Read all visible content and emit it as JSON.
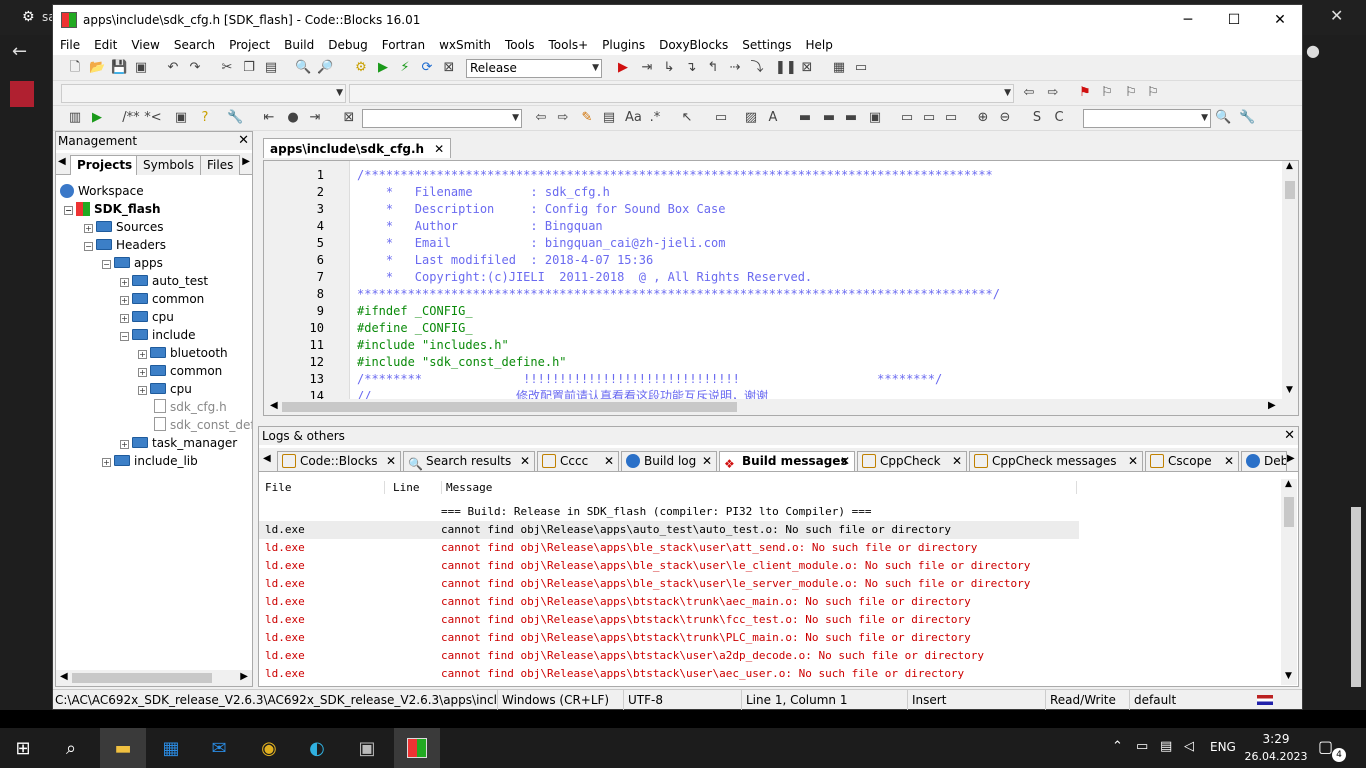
{
  "window": {
    "title": "apps\\include\\sdk_cfg.h [SDK_flash] - Code::Blocks 16.01"
  },
  "bg": {
    "left_text": "sa"
  },
  "menu": [
    "File",
    "Edit",
    "View",
    "Search",
    "Project",
    "Build",
    "Debug",
    "Fortran",
    "wxSmith",
    "Tools",
    "Tools+",
    "Plugins",
    "DoxyBlocks",
    "Settings",
    "Help"
  ],
  "toolbar": {
    "build_target": "Release",
    "comment_labels": [
      "/**",
      "*<"
    ],
    "scope_combo": "",
    "search_combo": ""
  },
  "management": {
    "title": "Management",
    "tabs": [
      "Projects",
      "Symbols",
      "Files"
    ],
    "tree": [
      {
        "label": "Workspace",
        "level": 0
      },
      {
        "label": "SDK_flash",
        "level": 1
      },
      {
        "label": "Sources",
        "level": 2
      },
      {
        "label": "Headers",
        "level": 2
      },
      {
        "label": "apps",
        "level": 3
      },
      {
        "label": "auto_test",
        "level": 4
      },
      {
        "label": "common",
        "level": 4
      },
      {
        "label": "cpu",
        "level": 4
      },
      {
        "label": "include",
        "level": 4
      },
      {
        "label": "bluetooth",
        "level": 5
      },
      {
        "label": "common",
        "level": 5
      },
      {
        "label": "cpu",
        "level": 5
      },
      {
        "label": "sdk_cfg.h",
        "level": 5
      },
      {
        "label": "sdk_const_def",
        "level": 5
      },
      {
        "label": "task_manager",
        "level": 4
      },
      {
        "label": "include_lib",
        "level": 3
      }
    ]
  },
  "editor": {
    "tab": "apps\\include\\sdk_cfg.h",
    "lines": [
      {
        "n": "1",
        "text": "/***************************************************************************************",
        "cls": "cm"
      },
      {
        "n": "2",
        "text": "    *   Filename        : sdk_cfg.h",
        "cls": "cm"
      },
      {
        "n": "3",
        "text": "    *   Description     : Config for Sound Box Case",
        "cls": "cm"
      },
      {
        "n": "4",
        "text": "    *   Author          : Bingquan",
        "cls": "cm"
      },
      {
        "n": "5",
        "text": "    *   Email           : bingquan_cai@zh-jieli.com",
        "cls": "cm"
      },
      {
        "n": "6",
        "text": "    *   Last modifiled  : 2018-4-07 15:36",
        "cls": "cm"
      },
      {
        "n": "7",
        "text": "    *   Copyright:(c)JIELI  2011-2018  @ , All Rights Reserved.",
        "cls": "cm"
      },
      {
        "n": "8",
        "text": "****************************************************************************************/",
        "cls": "cm"
      },
      {
        "n": "9",
        "text": "#ifndef _CONFIG_",
        "cls": "pp"
      },
      {
        "n": "10",
        "text": "#define _CONFIG_",
        "cls": "pp"
      },
      {
        "n": "11",
        "text": "#include \"includes.h\"",
        "cls": "pp"
      },
      {
        "n": "12",
        "text": "#include \"sdk_const_define.h\"",
        "cls": "pp"
      },
      {
        "n": "13",
        "text": "/********              !!!!!!!!!!!!!!!!!!!!!!!!!!!!!!                   ********/",
        "cls": "cm"
      },
      {
        "n": "14",
        "text": "//                    修改配置前请认真看看这段功能互斥说明，谢谢",
        "cls": "cm"
      }
    ]
  },
  "logs": {
    "title": "Logs & others",
    "tabs": [
      "Code::Blocks",
      "Search results",
      "Cccc",
      "Build log",
      "Build messages",
      "CppCheck",
      "CppCheck messages",
      "Cscope",
      "Debu"
    ],
    "columns": [
      "File",
      "Line",
      "Message"
    ],
    "header_msg": "=== Build: Release in SDK_flash (compiler: PI32 lto Compiler) ===",
    "rows": [
      {
        "file": "ld.exe",
        "msg": "cannot find obj\\Release\\apps\\auto_test\\auto_test.o: No such file or directory",
        "sel": true
      },
      {
        "file": "ld.exe",
        "msg": "cannot find obj\\Release\\apps\\ble_stack\\user\\att_send.o: No such file or directory"
      },
      {
        "file": "ld.exe",
        "msg": "cannot find obj\\Release\\apps\\ble_stack\\user\\le_client_module.o: No such file or directory"
      },
      {
        "file": "ld.exe",
        "msg": "cannot find obj\\Release\\apps\\ble_stack\\user\\le_server_module.o: No such file or directory"
      },
      {
        "file": "ld.exe",
        "msg": "cannot find obj\\Release\\apps\\btstack\\trunk\\aec_main.o: No such file or directory"
      },
      {
        "file": "ld.exe",
        "msg": "cannot find obj\\Release\\apps\\btstack\\trunk\\fcc_test.o: No such file or directory"
      },
      {
        "file": "ld.exe",
        "msg": "cannot find obj\\Release\\apps\\btstack\\trunk\\PLC_main.o: No such file or directory"
      },
      {
        "file": "ld.exe",
        "msg": "cannot find obj\\Release\\apps\\btstack\\user\\a2dp_decode.o: No such file or directory"
      },
      {
        "file": "ld.exe",
        "msg": "cannot find obj\\Release\\apps\\btstack\\user\\aec_user.o: No such file or directory"
      }
    ]
  },
  "status": {
    "path": "C:\\AC\\AC692x_SDK_release_V2.6.3\\AC692x_SDK_release_V2.6.3\\apps\\include\\sdk_cfg.h",
    "eol": "Windows (CR+LF)",
    "enc": "UTF-8",
    "pos": "Line 1, Column 1",
    "mode": "Insert",
    "rw": "Read/Write",
    "theme": "default"
  },
  "taskbar": {
    "lang": "ENG",
    "time": "3:29",
    "date": "26.04.2023",
    "notif": "4"
  },
  "colors": {
    "error": "#cc0000",
    "comment": "#6a6af0",
    "preproc": "#0a8a0a",
    "taskbar": "#1c1c1c"
  }
}
